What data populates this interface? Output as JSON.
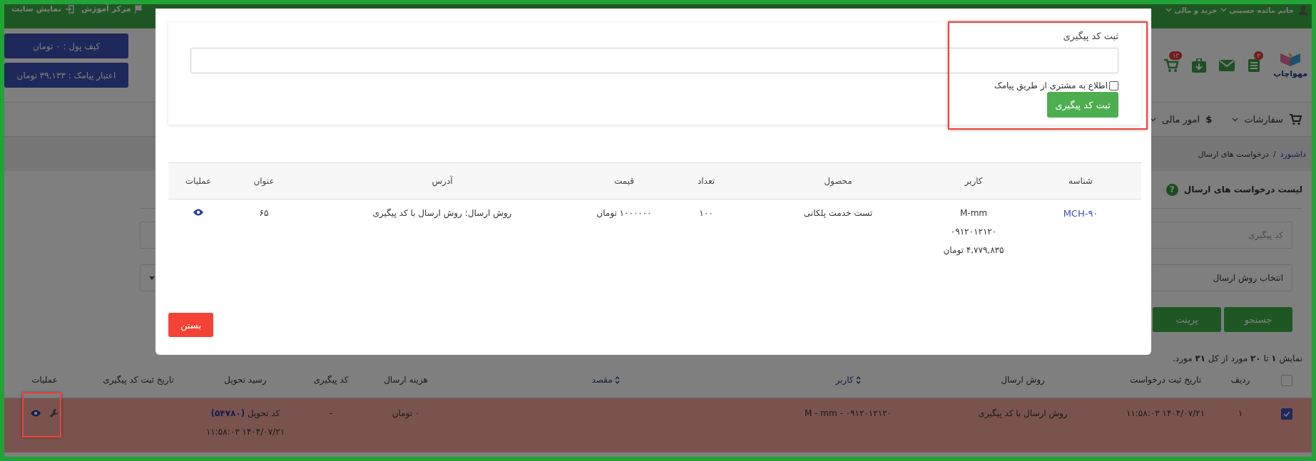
{
  "topbar": {
    "user": "خانم مائده حسینی",
    "menus": [
      "خرید و مالی"
    ],
    "links": [
      {
        "kind": "flag",
        "label": "مرکز آموزش"
      },
      {
        "kind": "enter",
        "label": "نمایش سایت"
      }
    ]
  },
  "header": {
    "logo": "مهواچاپ",
    "icons": [
      {
        "kind": "list",
        "badge": "۲"
      },
      {
        "kind": "mail"
      },
      {
        "kind": "download"
      },
      {
        "kind": "cart",
        "badge": "۱۳"
      }
    ],
    "wallet": "کیف پول : ۰ تومان",
    "sms_credit": "اعتبار پیامک : ۳۹,۱۳۳ تومان"
  },
  "nav": [
    {
      "kind": "cart",
      "label": "سفارشات"
    },
    {
      "kind": "symbol",
      "symbol": "$",
      "label": "امور مالی"
    }
  ],
  "breadcrumb": {
    "items": [
      "داشبورد",
      "درخواست های ارسال"
    ],
    "separator": "/"
  },
  "page": {
    "title": "لیست درخواست های ارسال",
    "help_symbol": "?",
    "filters": [
      {
        "kind": "text",
        "placeholder": "کد پیگیری"
      },
      {
        "kind": "select",
        "placeholder": "انتخاب روش ارسال"
      }
    ],
    "buttons": [
      "جستجو",
      "پرینت"
    ],
    "summary": "نمایش **۱** تا **۲۰** مورد از کل **۳۱** مورد."
  },
  "table": {
    "all_checked": false,
    "columns": [
      {
        "label": "ردیف",
        "sortable": false
      },
      {
        "label": "تاریخ ثبت درخواست",
        "sortable": false
      },
      {
        "label": "روش ارسال",
        "sortable": false
      },
      {
        "label": "کاربر",
        "sortable": true
      },
      {
        "label": "مقصد",
        "sortable": true
      },
      {
        "label": "هزینه ارسال",
        "sortable": false
      },
      {
        "label": "کد پیگیری",
        "sortable": false
      },
      {
        "label": "رسید تحویل",
        "sortable": false
      },
      {
        "label": "تاریخ ثبت کد پیگیری",
        "sortable": false
      },
      {
        "label": "عملیات",
        "sortable": false
      }
    ],
    "rows": [
      {
        "selected": true,
        "number": "۱",
        "date": "۱۴۰۴/۰۷/۲۱ ۱۱:۵۸:۰۳",
        "method": "روش ارسال با کد پیگیری",
        "user": "M - mm - ۰۹۱۲۰۱۲۱۲۰",
        "cost": "۰ تومان",
        "tracking_code": "-",
        "receipt": "کد تحویل **(۵۴۷۸۰)**",
        "receipt_date": "۱۴۰۴/۰۷/۲۱ ۱۱:۵۸:۰۳"
      }
    ]
  },
  "modal": {
    "form": {
      "label": "ثبت کد پیگیری",
      "notify_label": "اطلاع به مشتری از طریق پیامک",
      "notify_checked": false,
      "submit": "ثبت کد پیگیری"
    },
    "table": {
      "columns": [
        "شناسه",
        "کاربر",
        "محصول",
        "تعداد",
        "قیمت",
        "آدرس",
        "عنوان",
        "عملیات"
      ],
      "rows": [
        {
          "id": "MCH-۹۰",
          "user": [
            "M-mm",
            "۰۹۱۲۰۱۲۱۲۰",
            "۴,۷۷۹,۸۳۵ تومان"
          ],
          "product": "تست خدمت پلکانی",
          "quantity": "۱۰۰",
          "price": "۱۰۰۰۰۰۰ تومان",
          "address": "روش ارسال: روش ارسال با کد پیگیری",
          "title": "۶۵"
        }
      ]
    },
    "close": "بستن"
  }
}
